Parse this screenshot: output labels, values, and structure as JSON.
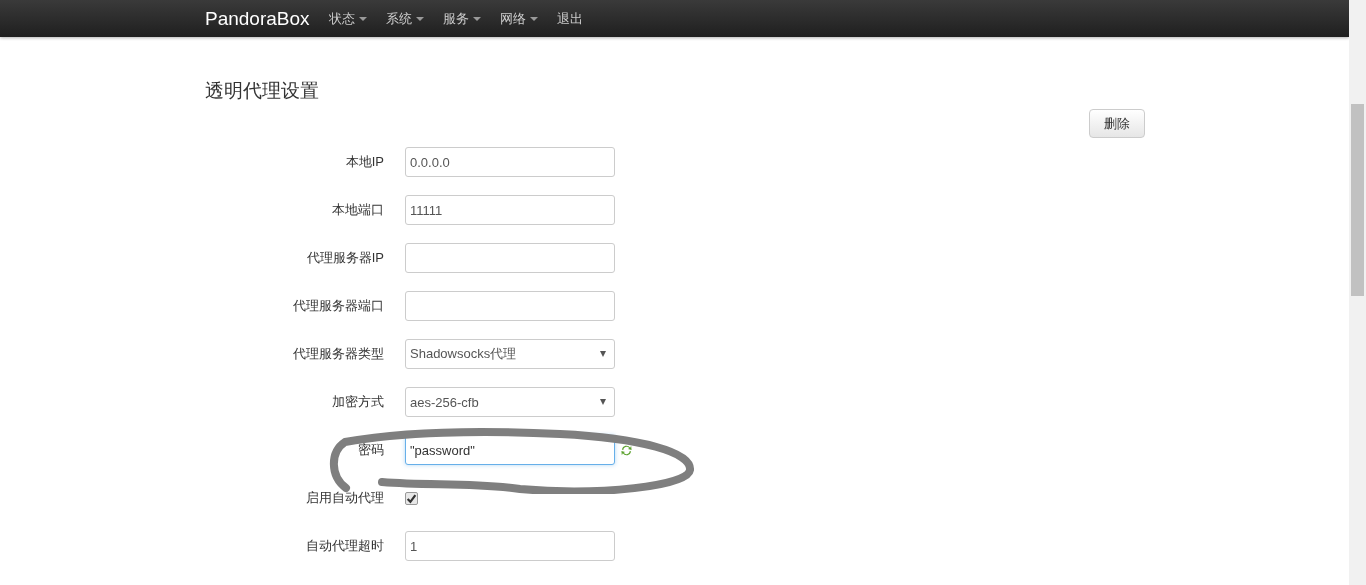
{
  "navbar": {
    "brand": "PandoraBox",
    "items": [
      {
        "label": "状态",
        "dropdown": true
      },
      {
        "label": "系统",
        "dropdown": true
      },
      {
        "label": "服务",
        "dropdown": true
      },
      {
        "label": "网络",
        "dropdown": true
      },
      {
        "label": "退出",
        "dropdown": false
      }
    ]
  },
  "page": {
    "title": "透明代理设置",
    "delete_button": "删除"
  },
  "fields": [
    {
      "kind": "text",
      "label": "本地IP",
      "value": "0.0.0.0",
      "focused": false
    },
    {
      "kind": "text",
      "label": "本地端口",
      "value": "11111",
      "focused": false
    },
    {
      "kind": "text",
      "label": "代理服务器IP",
      "focused": false
    },
    {
      "kind": "text",
      "label": "代理服务器端口",
      "focused": false
    },
    {
      "kind": "select",
      "label": "代理服务器类型",
      "value": "Shadowsocks代理",
      "focused": false
    },
    {
      "kind": "select",
      "label": "加密方式",
      "value": "aes-256-cfb",
      "focused": false
    },
    {
      "kind": "password",
      "label": "密码",
      "value": "\"password\"",
      "focused": true
    },
    {
      "kind": "checkbox",
      "label": "启用自动代理",
      "checked": true
    },
    {
      "kind": "text",
      "label": "自动代理超时",
      "value": "1",
      "focused": false
    }
  ]
}
